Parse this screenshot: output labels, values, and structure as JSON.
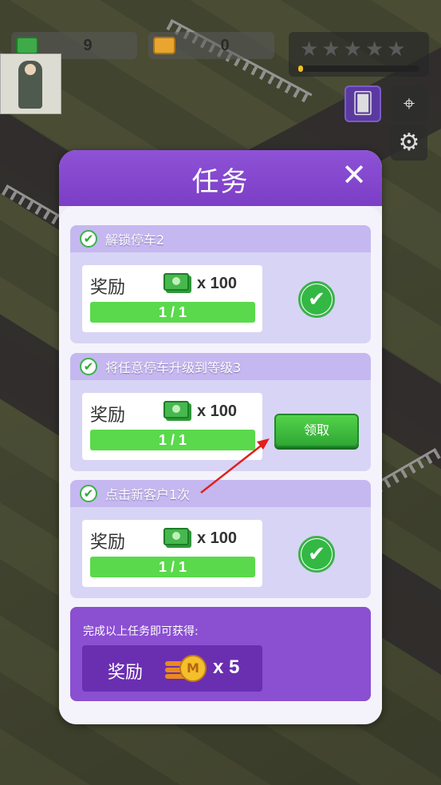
{
  "hud": {
    "cash": "9",
    "tickets": "0",
    "stars_total": 5,
    "stars_filled": 0,
    "star_progress": 0.04
  },
  "modal": {
    "title": "任务",
    "close_glyph": "✕"
  },
  "tasks": [
    {
      "name": "解锁停车2",
      "reward_label": "奖励",
      "reward_amount": "x 100",
      "progress_text": "1 / 1",
      "progress": 1.0,
      "status": "completed"
    },
    {
      "name": "将任意停车升级到等级3",
      "reward_label": "奖励",
      "reward_amount": "x 100",
      "progress_text": "1 / 1",
      "progress": 1.0,
      "status": "claimable",
      "claim_label": "领取"
    },
    {
      "name": "点击新客户1次",
      "reward_label": "奖励",
      "reward_amount": "x 100",
      "progress_text": "1 / 1",
      "progress": 1.0,
      "status": "completed"
    }
  ],
  "summary": {
    "label": "完成以上任务即可获得:",
    "reward_label": "奖励",
    "coin_glyph": "M",
    "reward_amount": "x 5"
  },
  "icons": {
    "check": "✔",
    "star": "★",
    "gear": "⚙",
    "cards": "🂠",
    "map_pin": "⌖"
  },
  "colors": {
    "modal_purple": "#7b3ec6",
    "progress_green": "#5ad94c",
    "claim_green": "#2fa835",
    "arrow_red": "#e0201a"
  }
}
